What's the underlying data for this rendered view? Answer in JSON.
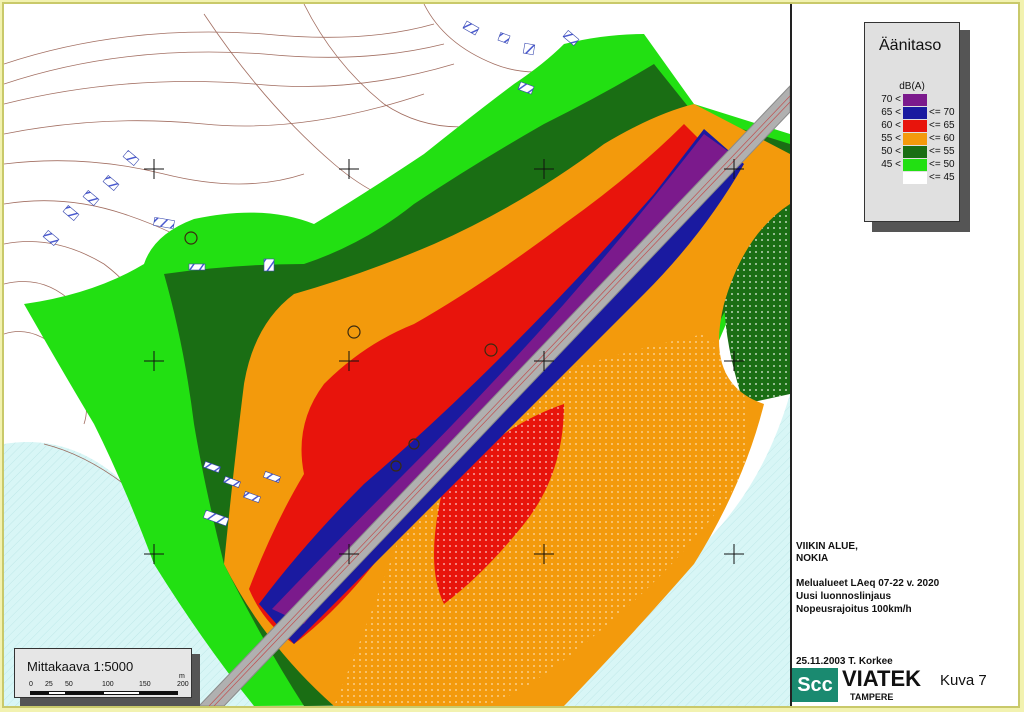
{
  "legend": {
    "title": "Äänitaso",
    "unit": "dB(A)",
    "rows": [
      {
        "lower": "70 <",
        "upper": "",
        "color": "#7b1a8c"
      },
      {
        "lower": "65 <",
        "upper": "<= 70",
        "color": "#1a1aa0"
      },
      {
        "lower": "60 <",
        "upper": "<= 65",
        "color": "#e8140c"
      },
      {
        "lower": "55 <",
        "upper": "<= 60",
        "color": "#f39a0c"
      },
      {
        "lower": "50 <",
        "upper": "<= 55",
        "color": "#1a6e14"
      },
      {
        "lower": "45 <",
        "upper": "<= 50",
        "color": "#22e012"
      },
      {
        "lower": "",
        "upper": "<= 45",
        "color": "#ffffff"
      }
    ]
  },
  "info": {
    "area_name": "VIIKIN ALUE,",
    "municipality": "NOKIA",
    "noise_title": "Melualueet LAeq 07-22 v. 2020",
    "alignment": "Uusi luonnoslinjaus",
    "speed_limit": "Nopeusrajoitus 100km/h",
    "date_author": "25.11.2003 T. Korkee"
  },
  "scale": {
    "label": "Mittakaava 1:5000",
    "ticks": [
      "0",
      "25",
      "50",
      "100",
      "150",
      "200"
    ],
    "unit": "m"
  },
  "logo": {
    "scc": "Scc",
    "viatek": "VIATEK",
    "city": "TAMPERE"
  },
  "figure_label": "Kuva 7",
  "colors": {
    "water": "#d4f4f4",
    "road": "#b0b0b0",
    "contour": "#8b4a3a"
  }
}
